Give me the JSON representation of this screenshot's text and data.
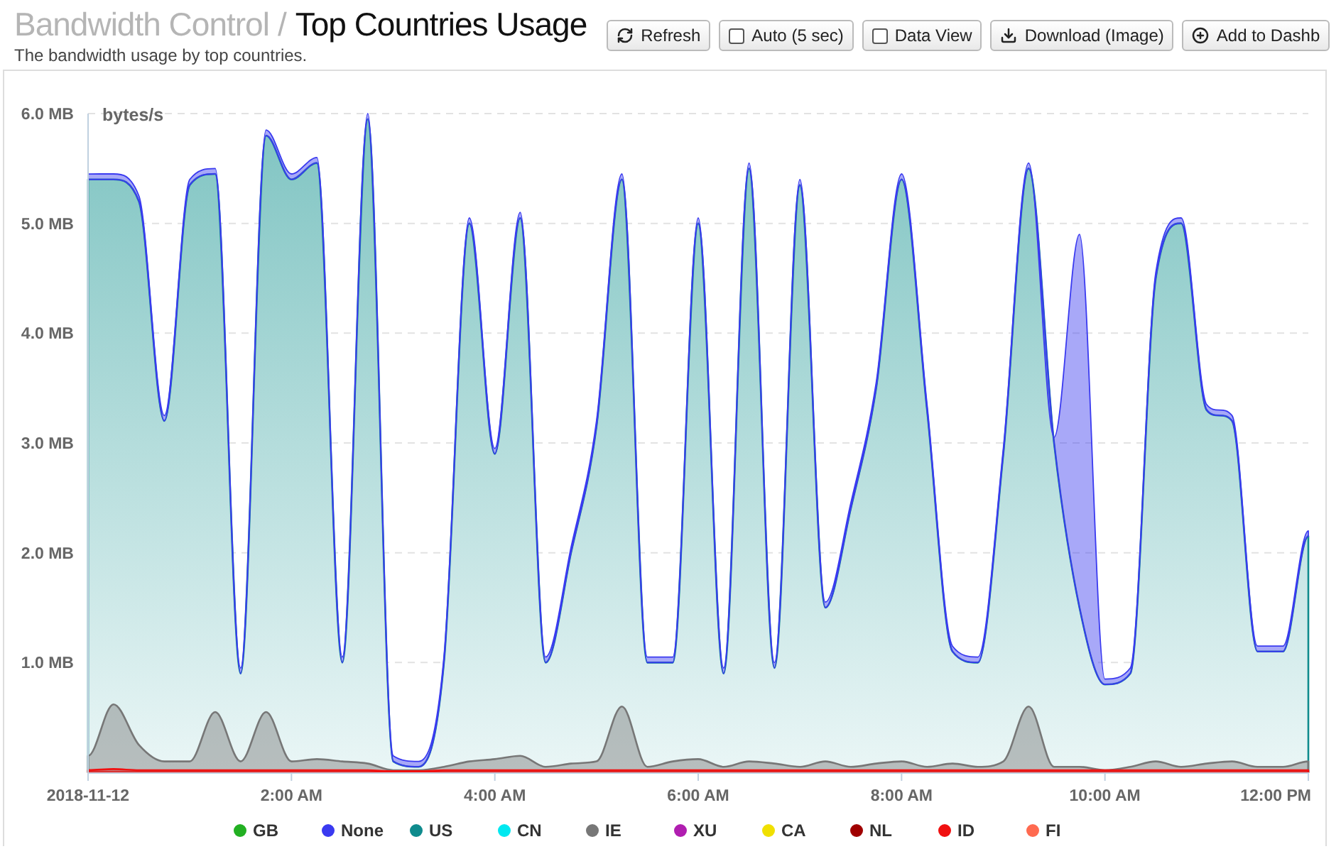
{
  "header": {
    "section": "Bandwidth Control",
    "separator": "/",
    "title": "Top Countries Usage",
    "subtitle": "The bandwidth usage by top countries."
  },
  "toolbar": [
    {
      "kind": "button",
      "label": "Refresh"
    },
    {
      "kind": "checkbox",
      "label": "Auto (5 sec)",
      "checked": false
    },
    {
      "kind": "checkbox",
      "label": "Data View",
      "checked": false
    },
    {
      "kind": "button",
      "label": "Download (Image)"
    },
    {
      "kind": "button",
      "label": "Add to Dashb"
    }
  ],
  "chart": {
    "chart_data": {
      "type": "area",
      "ylabel": "bytes/s",
      "stacked": false,
      "grid": true,
      "legend": true,
      "x": [
        0,
        0.25,
        0.5,
        0.75,
        1,
        1.25,
        1.5,
        1.75,
        2,
        2.25,
        2.5,
        2.75,
        3,
        3.25,
        3.5,
        3.75,
        4,
        4.25,
        4.5,
        4.75,
        5,
        5.25,
        5.5,
        5.75,
        6,
        6.25,
        6.5,
        6.75,
        7,
        7.25,
        7.5,
        7.75,
        8,
        8.25,
        8.5,
        8.75,
        9,
        9.25,
        9.5,
        9.75,
        10,
        10.25,
        10.5,
        10.75,
        11,
        11.25,
        11.5,
        11.75,
        12
      ],
      "xlim": [
        0,
        12
      ],
      "xticks": [
        {
          "value": 0,
          "label": "2018-11-12"
        },
        {
          "value": 2,
          "label": "2:00 AM"
        },
        {
          "value": 4,
          "label": "4:00 AM"
        },
        {
          "value": 6,
          "label": "6:00 AM"
        },
        {
          "value": 8,
          "label": "8:00 AM"
        },
        {
          "value": 10,
          "label": "10:00 AM"
        },
        {
          "value": 12,
          "label": "12:00 PM"
        }
      ],
      "ylim": [
        0,
        6
      ],
      "yticks": [
        {
          "value": 1,
          "label": "1.0 MB"
        },
        {
          "value": 2,
          "label": "2.0 MB"
        },
        {
          "value": 3,
          "label": "3.0 MB"
        },
        {
          "value": 4,
          "label": "4.0 MB"
        },
        {
          "value": 5,
          "label": "5.0 MB"
        },
        {
          "value": 6,
          "label": "6.0 MB"
        }
      ],
      "series": [
        {
          "name": "GB",
          "color": "#22b022",
          "values": [
            null,
            null,
            null,
            null,
            null,
            null,
            null,
            null,
            null,
            null,
            null,
            null,
            null,
            null,
            null,
            null,
            null,
            null,
            null,
            null,
            null,
            null,
            null,
            null,
            null,
            null,
            null,
            null,
            null,
            null,
            null,
            null,
            null,
            null,
            null,
            null,
            null,
            null,
            null,
            null,
            null,
            null,
            null,
            null,
            null,
            null,
            null,
            null,
            null
          ]
        },
        {
          "name": "None",
          "color": "#3a3af0",
          "values": [
            5.45,
            5.45,
            5.25,
            3.25,
            5.4,
            5.5,
            0.95,
            5.85,
            5.45,
            5.6,
            1.05,
            6.0,
            0.15,
            0.1,
            1.05,
            5.05,
            2.95,
            5.1,
            1.05,
            2.05,
            3.2,
            5.45,
            1.05,
            1.05,
            5.05,
            0.95,
            5.55,
            1.0,
            5.4,
            1.55,
            2.45,
            3.55,
            5.45,
            3.35,
            1.15,
            1.05,
            2.95,
            5.55,
            3.05,
            4.9,
            0.85,
            0.95,
            4.55,
            5.05,
            3.35,
            3.25,
            1.15,
            1.15,
            2.2
          ]
        },
        {
          "name": "US",
          "color": "#0f8b8d",
          "values": [
            5.4,
            5.4,
            5.2,
            3.2,
            5.35,
            5.45,
            0.9,
            5.8,
            5.4,
            5.55,
            1.0,
            5.95,
            0.1,
            0.05,
            1.0,
            5.0,
            2.9,
            5.05,
            1.0,
            2.0,
            3.15,
            5.4,
            1.0,
            1.0,
            5.0,
            0.9,
            5.5,
            0.95,
            5.35,
            1.5,
            2.4,
            3.5,
            5.4,
            3.3,
            1.1,
            1.0,
            2.9,
            5.5,
            3.0,
            1.5,
            0.8,
            0.9,
            4.5,
            5.0,
            3.3,
            3.2,
            1.1,
            1.1,
            2.15
          ]
        },
        {
          "name": "CN",
          "color": "#00e8f0",
          "values": [
            null,
            null,
            null,
            null,
            null,
            null,
            null,
            null,
            null,
            null,
            null,
            null,
            null,
            null,
            null,
            null,
            null,
            null,
            null,
            null,
            null,
            null,
            null,
            null,
            null,
            null,
            null,
            null,
            null,
            null,
            null,
            null,
            null,
            null,
            null,
            null,
            null,
            null,
            null,
            null,
            null,
            null,
            null,
            null,
            null,
            null,
            null,
            null,
            null
          ]
        },
        {
          "name": "IE",
          "color": "#777777",
          "values": [
            0.15,
            0.62,
            0.25,
            0.1,
            0.1,
            0.55,
            0.1,
            0.55,
            0.1,
            0.12,
            0.1,
            0.08,
            0.02,
            0.02,
            0.05,
            0.1,
            0.12,
            0.15,
            0.05,
            0.08,
            0.1,
            0.6,
            0.05,
            0.1,
            0.12,
            0.05,
            0.1,
            0.08,
            0.05,
            0.1,
            0.05,
            0.08,
            0.1,
            0.05,
            0.08,
            0.05,
            0.1,
            0.6,
            0.05,
            0.05,
            0.02,
            0.05,
            0.1,
            0.05,
            0.08,
            0.1,
            0.05,
            0.05,
            0.1
          ]
        },
        {
          "name": "XU",
          "color": "#b01eb0",
          "values": [
            null,
            null,
            null,
            null,
            null,
            null,
            null,
            null,
            null,
            null,
            null,
            null,
            null,
            null,
            null,
            null,
            null,
            null,
            null,
            null,
            null,
            null,
            null,
            null,
            null,
            null,
            null,
            null,
            null,
            null,
            null,
            null,
            null,
            null,
            null,
            null,
            null,
            null,
            null,
            null,
            null,
            null,
            null,
            null,
            null,
            null,
            null,
            null,
            null
          ]
        },
        {
          "name": "CA",
          "color": "#f0e000",
          "values": [
            null,
            null,
            null,
            null,
            null,
            null,
            null,
            null,
            null,
            null,
            null,
            null,
            null,
            null,
            null,
            null,
            null,
            null,
            null,
            null,
            null,
            null,
            null,
            null,
            null,
            null,
            null,
            null,
            null,
            null,
            null,
            null,
            null,
            null,
            null,
            null,
            null,
            null,
            null,
            null,
            null,
            null,
            null,
            null,
            null,
            null,
            null,
            null,
            null
          ]
        },
        {
          "name": "NL",
          "color": "#a00000",
          "values": [
            null,
            null,
            null,
            null,
            null,
            null,
            null,
            null,
            null,
            null,
            null,
            null,
            null,
            null,
            null,
            null,
            null,
            null,
            null,
            null,
            null,
            null,
            null,
            null,
            null,
            null,
            null,
            null,
            null,
            null,
            null,
            null,
            null,
            null,
            null,
            null,
            null,
            null,
            null,
            null,
            null,
            null,
            null,
            null,
            null,
            null,
            null,
            null,
            null
          ]
        },
        {
          "name": "ID",
          "color": "#f01010",
          "values": [
            0.02,
            0.03,
            0.02,
            0.02,
            0.02,
            0.02,
            0.02,
            0.02,
            0.02,
            0.02,
            0.02,
            0.02,
            0.01,
            0.01,
            0.02,
            0.02,
            0.02,
            0.02,
            0.02,
            0.02,
            0.02,
            0.02,
            0.02,
            0.02,
            0.02,
            0.02,
            0.02,
            0.02,
            0.02,
            0.02,
            0.02,
            0.02,
            0.02,
            0.02,
            0.02,
            0.02,
            0.02,
            0.02,
            0.02,
            0.02,
            0.02,
            0.02,
            0.02,
            0.02,
            0.02,
            0.02,
            0.02,
            0.02,
            0.02
          ]
        },
        {
          "name": "FI",
          "color": "#ff6a50",
          "values": [
            null,
            null,
            null,
            null,
            null,
            null,
            null,
            null,
            null,
            null,
            null,
            null,
            null,
            null,
            null,
            null,
            null,
            null,
            null,
            null,
            null,
            null,
            null,
            null,
            null,
            null,
            null,
            null,
            null,
            null,
            null,
            null,
            null,
            null,
            null,
            null,
            null,
            null,
            null,
            null,
            null,
            null,
            null,
            null,
            null,
            null,
            null,
            null,
            null
          ]
        }
      ]
    }
  }
}
